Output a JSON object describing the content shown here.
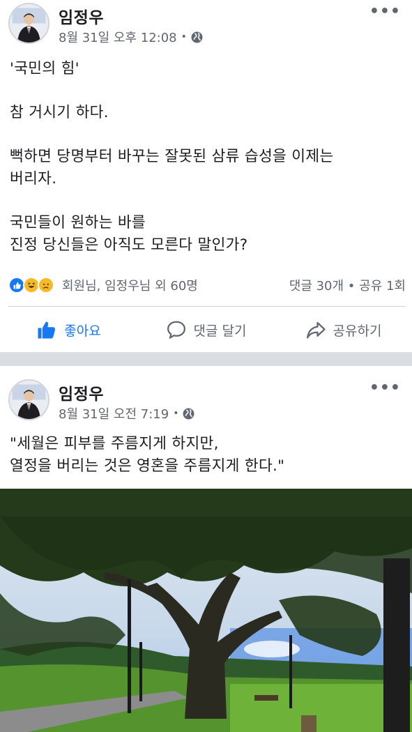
{
  "posts": [
    {
      "author": "임정우",
      "timestamp": "8월 31일 오후 12:08",
      "privacy_separator": "•",
      "more_label": "•••",
      "lines": [
        "'국민의 힘'",
        "",
        "참 거시기 하다.",
        "",
        "뻑하면 당명부터 바꾸는 잘못된 삼류 습성을 이제는",
        "버리자.",
        "",
        "국민들이 원하는 바를",
        "진정 당신들은 아직도 모른다 말인가?"
      ],
      "reactions_text": "회원님, 임정우님 외 60명",
      "counts_text": "댓글 30개 • 공유 1회",
      "actions": {
        "like": "좋아요",
        "comment": "댓글 달기",
        "share": "공유하기"
      }
    },
    {
      "author": "임정우",
      "timestamp": "8월 31일 오전 7:19",
      "privacy_separator": "•",
      "more_label": "•••",
      "lines": [
        "\"세월은 피부를 주름지게 하지만,",
        "열정을 버리는 것은 영혼을 주름지게 한다.\""
      ]
    }
  ],
  "icons": {
    "privacy": "globe-icon",
    "like": "thumbs-up-icon",
    "comment": "speech-bubble-icon",
    "share": "share-arrow-icon",
    "reactions": [
      "like-reaction-icon",
      "haha-reaction-icon",
      "sad-reaction-icon"
    ]
  },
  "colors": {
    "accent": "#1877f2",
    "meta": "#606770",
    "separator": "#dadde1"
  }
}
